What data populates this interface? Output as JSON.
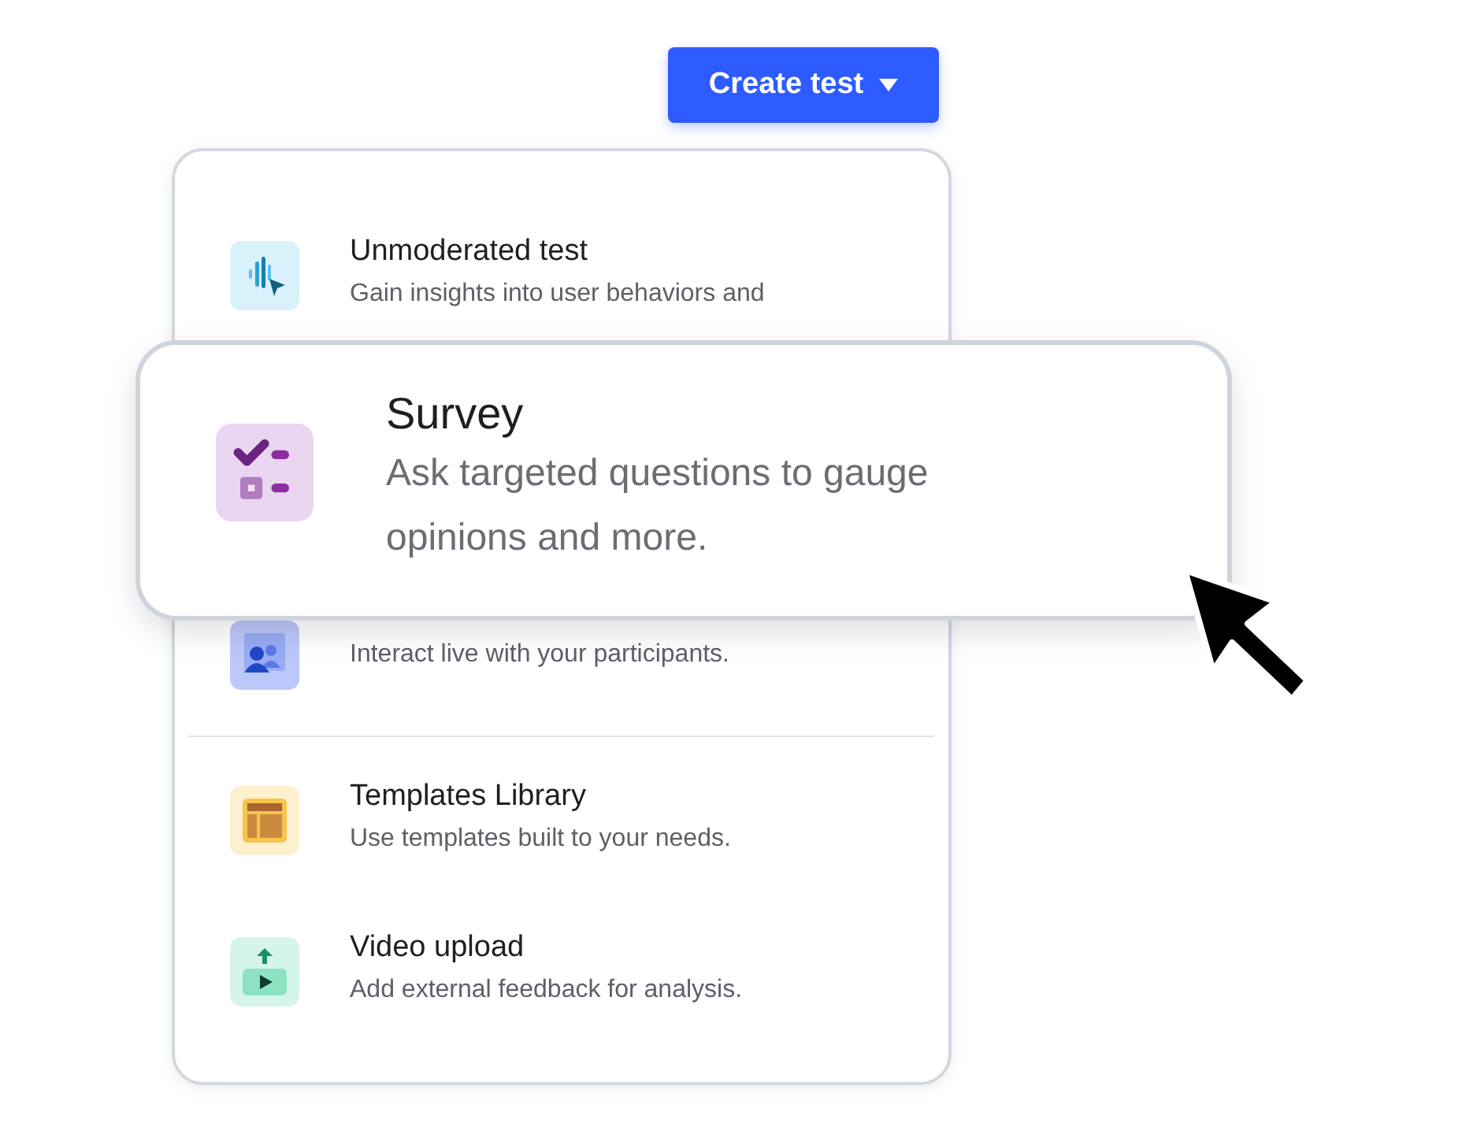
{
  "create_button": {
    "label": "Create test"
  },
  "menu": {
    "groups": [
      {
        "items": [
          {
            "kind": "unmoderated",
            "title": "Unmoderated test",
            "description": "Gain insights into user behaviors and"
          },
          {
            "kind": "live",
            "description": "Interact live with your participants."
          }
        ]
      },
      {
        "items": [
          {
            "kind": "templates",
            "title": "Templates Library",
            "description": "Use templates built to your needs."
          },
          {
            "kind": "video",
            "title": "Video upload",
            "description": "Add external feedback for analysis."
          }
        ]
      }
    ]
  },
  "highlighted_card": {
    "kind": "survey",
    "title": "Survey",
    "description": "Ask targeted questions to gauge opinions and more."
  }
}
